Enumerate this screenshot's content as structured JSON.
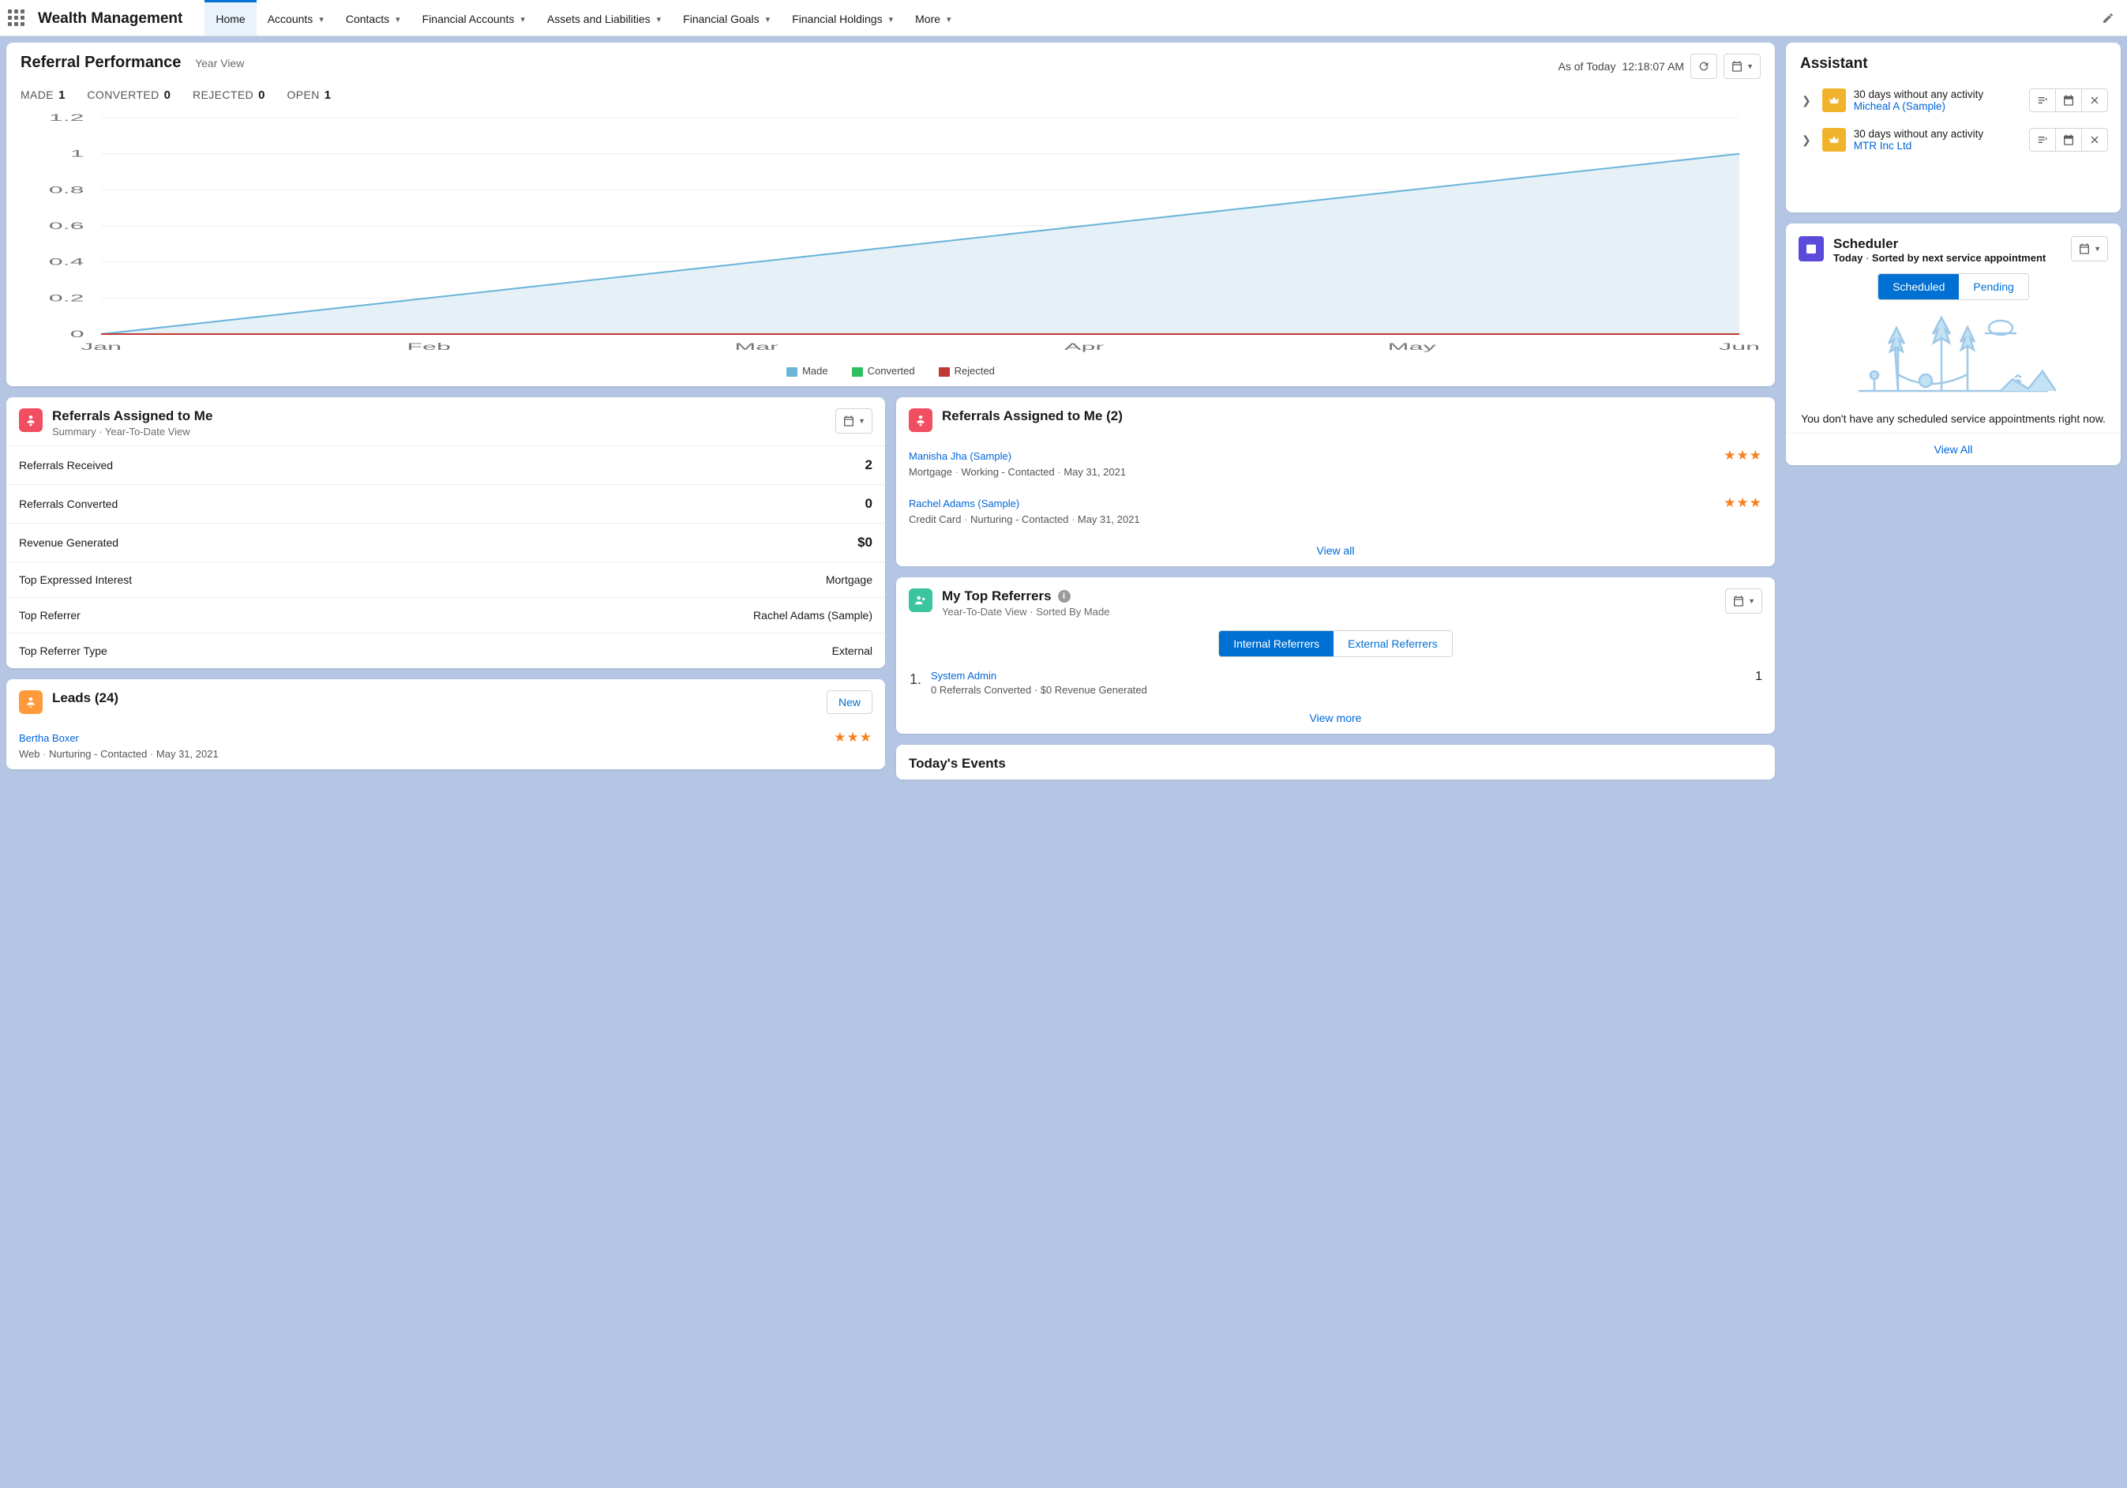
{
  "app_title": "Wealth Management",
  "nav": [
    "Home",
    "Accounts",
    "Contacts",
    "Financial Accounts",
    "Assets and Liabilities",
    "Financial Goals",
    "Financial Holdings",
    "More"
  ],
  "nav_active_index": 0,
  "referral_perf": {
    "title": "Referral Performance",
    "view": "Year View",
    "as_of_label": "As of Today",
    "as_of_time": "12:18:07 AM",
    "stats": {
      "made_label": "MADE",
      "made": "1",
      "converted_label": "CONVERTED",
      "converted": "0",
      "rejected_label": "REJECTED",
      "rejected": "0",
      "open_label": "OPEN",
      "open": "1"
    },
    "legend": {
      "made": "Made",
      "converted": "Converted",
      "rejected": "Rejected"
    }
  },
  "chart_data": {
    "type": "line",
    "title": "Referral Performance",
    "xlabel": "",
    "ylabel": "",
    "ylim": [
      0,
      1.2
    ],
    "categories": [
      "Jan",
      "Feb",
      "Mar",
      "Apr",
      "May",
      "Jun"
    ],
    "series": [
      {
        "name": "Made",
        "color": "#6cb5d9",
        "values": [
          0,
          0.2,
          0.4,
          0.6,
          0.8,
          1.0
        ]
      },
      {
        "name": "Converted",
        "color": "#2fbf63",
        "values": [
          0,
          0,
          0,
          0,
          0,
          0
        ]
      },
      {
        "name": "Rejected",
        "color": "#c23934",
        "values": [
          0,
          0,
          0,
          0,
          0,
          0
        ]
      }
    ],
    "y_ticks": [
      0,
      0.2,
      0.4,
      0.6,
      0.8,
      1,
      1.2
    ]
  },
  "ref_summary": {
    "title": "Referrals Assigned to Me",
    "sub": "Summary  ·  Year-To-Date View",
    "rows": [
      {
        "label": "Referrals Received",
        "value": "2"
      },
      {
        "label": "Referrals Converted",
        "value": "0"
      },
      {
        "label": "Revenue Generated",
        "value": "$0"
      },
      {
        "label": "Top Expressed Interest",
        "value": "Mortgage"
      },
      {
        "label": "Top Referrer",
        "value": "Rachel Adams (Sample)"
      },
      {
        "label": "Top Referrer Type",
        "value": "External"
      }
    ]
  },
  "ref_list": {
    "title": "Referrals Assigned to Me (2)",
    "items": [
      {
        "name": "Manisha Jha (Sample)",
        "m1": "Mortgage",
        "m2": "Working - Contacted",
        "m3": "May 31, 2021"
      },
      {
        "name": "Rachel Adams (Sample)",
        "m1": "Credit Card",
        "m2": "Nurturing - Contacted",
        "m3": "May 31, 2021"
      }
    ],
    "view_all": "View all"
  },
  "top_referrers": {
    "title": "My Top Referrers",
    "sub": "Year-To-Date View  ·  Sorted By Made",
    "pill_internal": "Internal Referrers",
    "pill_external": "External Referrers",
    "items": [
      {
        "rank": "1.",
        "name": "System Admin",
        "meta": "0 Referrals Converted  ·  $0 Revenue Generated",
        "score": "1"
      }
    ],
    "view_more": "View more"
  },
  "leads": {
    "title": "Leads (24)",
    "new_label": "New",
    "items": [
      {
        "name": "Bertha Boxer",
        "m1": "Web",
        "m2": "Nurturing - Contacted",
        "m3": "May 31, 2021"
      }
    ]
  },
  "todays_events": {
    "title": "Today's Events"
  },
  "assistant": {
    "title": "Assistant",
    "items": [
      {
        "msg": "30 days without any activity",
        "who": "Micheal A (Sample)"
      },
      {
        "msg": "30 days without any activity",
        "who": "MTR Inc Ltd"
      }
    ]
  },
  "scheduler": {
    "title": "Scheduler",
    "sub_today": "Today",
    "sub_sort": "Sorted by next service appointment",
    "pill_scheduled": "Scheduled",
    "pill_pending": "Pending",
    "empty_msg": "You don't have any scheduled service appointments right now.",
    "view_all": "View All"
  }
}
